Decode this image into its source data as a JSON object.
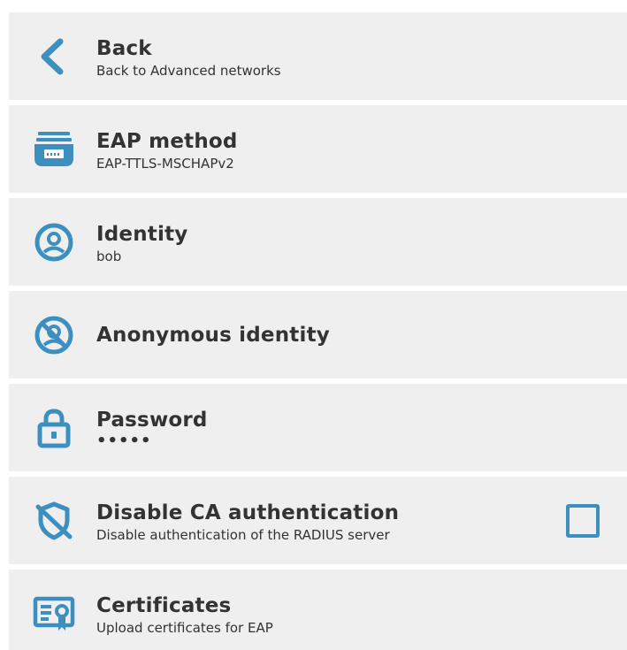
{
  "colors": {
    "accent": "#3d8fc0",
    "row_bg": "#efefef",
    "text": "#333333"
  },
  "items": [
    {
      "icon": "chevron-left-icon",
      "title": "Back",
      "subtitle": "Back to Advanced networks"
    },
    {
      "icon": "eap-method-icon",
      "title": "EAP method",
      "subtitle": "EAP-TTLS-MSCHAPv2"
    },
    {
      "icon": "user-circle-icon",
      "title": "Identity",
      "subtitle": "bob"
    },
    {
      "icon": "anonymous-user-icon",
      "title": "Anonymous identity",
      "subtitle": ""
    },
    {
      "icon": "lock-icon",
      "title": "Password",
      "subtitle": "•••••"
    },
    {
      "icon": "shield-off-icon",
      "title": "Disable CA authentication",
      "subtitle": "Disable authentication of the RADIUS server",
      "checkbox_checked": false
    },
    {
      "icon": "certificate-icon",
      "title": "Certificates",
      "subtitle": "Upload certificates for EAP"
    }
  ]
}
